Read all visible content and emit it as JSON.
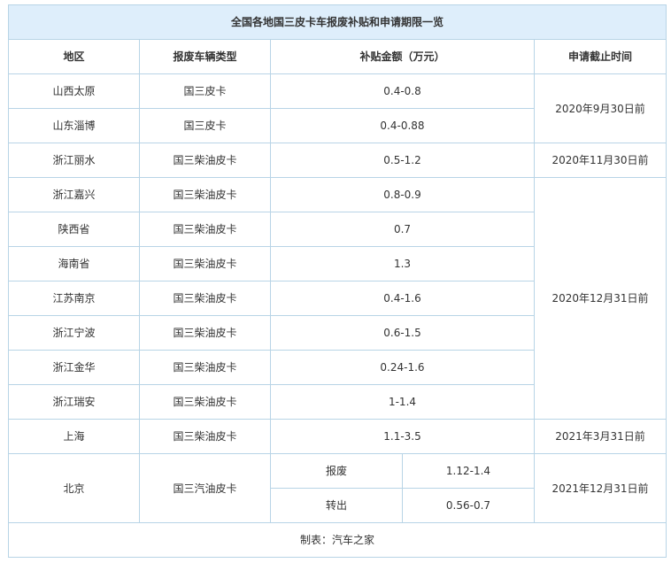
{
  "table": {
    "title": "全国各地国三皮卡车报废补贴和申请期限一览",
    "headers": [
      "地区",
      "报废车辆类型",
      "补贴金额（万元）",
      "申请截止时间"
    ],
    "rows": [
      {
        "region": "山西太原",
        "type": "国三皮卡",
        "amount": "0.4-0.8"
      },
      {
        "region": "山东淄博",
        "type": "国三皮卡",
        "amount": "0.4-0.88"
      },
      {
        "region": "浙江丽水",
        "type": "国三柴油皮卡",
        "amount": "0.5-1.2"
      },
      {
        "region": "浙江嘉兴",
        "type": "国三柴油皮卡",
        "amount": "0.8-0.9"
      },
      {
        "region": "陕西省",
        "type": "国三柴油皮卡",
        "amount": "0.7"
      },
      {
        "region": "海南省",
        "type": "国三柴油皮卡",
        "amount": "1.3"
      },
      {
        "region": "江苏南京",
        "type": "国三柴油皮卡",
        "amount": "0.4-1.6"
      },
      {
        "region": "浙江宁波",
        "type": "国三柴油皮卡",
        "amount": "0.6-1.5"
      },
      {
        "region": "浙江金华",
        "type": "国三柴油皮卡",
        "amount": "0.24-1.6"
      },
      {
        "region": "浙江瑞安",
        "type": "国三柴油皮卡",
        "amount": "1-1.4"
      },
      {
        "region": "上海",
        "type": "国三柴油皮卡",
        "amount": "1.1-3.5"
      }
    ],
    "deadlines": {
      "shanxi_shandong": "2020年9月30日前",
      "lishui": "2020年11月30日前",
      "group_2020_12": "2020年12月31日前",
      "shanghai": "2021年3月31日前",
      "beijing": "2021年12月31日前"
    },
    "beijing": {
      "region": "北京",
      "type": "国三汽油皮卡",
      "sub": [
        {
          "label": "报废",
          "amount": "1.12-1.4"
        },
        {
          "label": "转出",
          "amount": "0.56-0.7"
        }
      ]
    },
    "footer": "制表：汽车之家"
  },
  "colors": {
    "border": "#b8d4e6",
    "title_bg": "#deeefb",
    "text": "#333333"
  }
}
